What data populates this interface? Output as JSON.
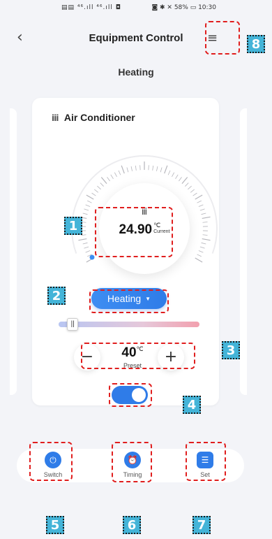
{
  "status_bar": {
    "left": "▤▤ ⁴⁶.ıll ⁴⁶.ıll ◘",
    "right": "◙ ✱ ✕ 58% ▭ 10:30"
  },
  "nav": {
    "back_icon": "‹",
    "title": "Equipment Control",
    "menu_icon": "≡"
  },
  "mode_title": "Heating",
  "device": {
    "icon": "ⅲ",
    "name": "Air Conditioner"
  },
  "current": {
    "icon": "ⅲ",
    "value": "24.90",
    "unit": "℃",
    "label": "Current"
  },
  "mode_dropdown": {
    "label": "Heating",
    "caret": "▼"
  },
  "slider": {
    "thumb": "||",
    "level": 0.1
  },
  "preset": {
    "minus": "−",
    "value": "40",
    "unit": "℃",
    "label": "Preset",
    "plus": "+"
  },
  "power_toggle": {
    "on": true
  },
  "tabs": [
    {
      "label": "Switch",
      "icon": "⏻",
      "icon_name": "power-icon"
    },
    {
      "label": "Timing",
      "icon": "⏰",
      "icon_name": "alarm-clock-icon"
    },
    {
      "label": "Set",
      "icon": "☰",
      "icon_name": "settings-sliders-icon"
    }
  ],
  "annotations": [
    "1",
    "2",
    "3",
    "4",
    "5",
    "6",
    "7",
    "8"
  ],
  "colors": {
    "accent": "#2f7ce8",
    "annotation_border": "#e01e1e",
    "annotation_badge": "#44b4d8"
  }
}
